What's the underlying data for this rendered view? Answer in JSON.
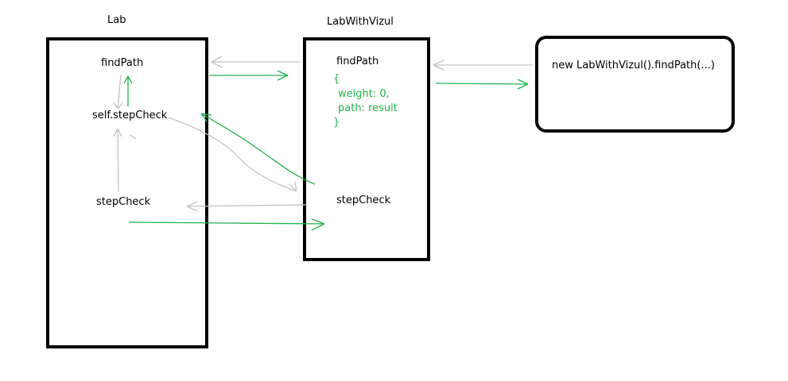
{
  "colors": {
    "gray_arrow": "#c3c3c3",
    "green_arrow": "#22b14c",
    "box_border": "#000000"
  },
  "lab": {
    "title": "Lab",
    "find_path": "findPath",
    "self_step_check": "self.stepCheck",
    "step_check": "stepCheck"
  },
  "lab_with_vizul": {
    "title": "LabWithVizul",
    "find_path": "findPath",
    "result": {
      "open_brace": "{",
      "line1": "weight: 0,",
      "line2": "path: result",
      "close_brace": "}"
    },
    "step_check": "stepCheck"
  },
  "caller": {
    "code": "new LabWithVizul().findPath(...)"
  }
}
